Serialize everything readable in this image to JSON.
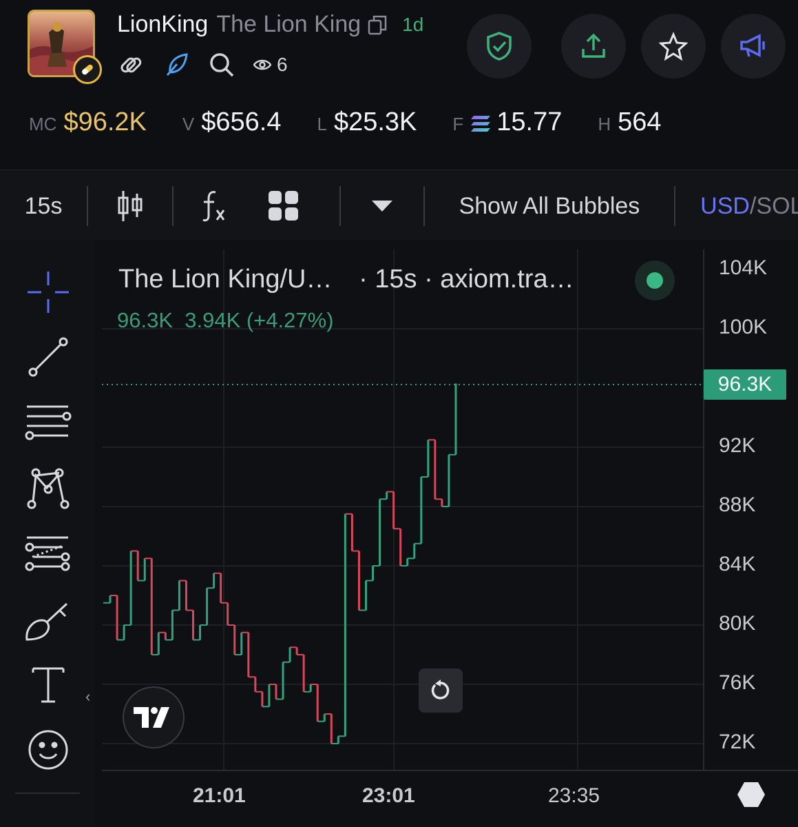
{
  "header": {
    "symbol": "LionKing",
    "name": "The Lion King",
    "age": "1d",
    "watchers": "6",
    "icons": [
      "copy-icon",
      "link-icon",
      "feather-icon",
      "search-icon",
      "eye-icon"
    ],
    "buttons": [
      "shield-check-icon",
      "share-upload-icon",
      "star-icon",
      "megaphone-icon"
    ],
    "colors": {
      "gold": "#e9c46a",
      "green": "#3db37b",
      "blue": "#5a6cf0"
    }
  },
  "stats": {
    "mc_key": "MC",
    "mc_value": "$96.2K",
    "v_key": "V",
    "v_value": "$656.4",
    "l_key": "L",
    "l_value": "$25.3K",
    "f_key": "F",
    "f_value": "15.77",
    "h_key": "H",
    "h_value": "564"
  },
  "toolbar": {
    "interval": "15s",
    "show_bubbles": "Show All Bubbles",
    "currency_active": "USD",
    "currency_sep": "/",
    "currency_other": "SOL"
  },
  "chart": {
    "legend_title": "The Lion King/U…",
    "legend_meta": "· 15s · axiom.tra…",
    "legend_values": "96.3K  3.94K (+4.27%)",
    "current_price_label": "96.3K",
    "y_ticks": [
      "104K",
      "100K",
      "92K",
      "88K",
      "84K",
      "80K",
      "76K",
      "72K"
    ],
    "x_ticks": [
      "21:01",
      "23:01",
      "23:35"
    ]
  },
  "chart_data": {
    "type": "line",
    "title": "The Lion King/U…",
    "xlabel": "",
    "ylabel": "",
    "x": [
      "21:01",
      "23:01",
      "23:35"
    ],
    "ylim": [
      72000,
      104000
    ],
    "series": [
      {
        "values": [
          81500,
          82000,
          79000,
          80000,
          85000,
          83000,
          84500,
          78000,
          79500,
          79000,
          81000,
          83000,
          81000,
          79000,
          80000,
          82500,
          83500,
          81500,
          80000,
          78000,
          79500,
          76500,
          75500,
          74500,
          76000,
          75000,
          77500,
          78500,
          78000,
          75500,
          76000,
          73500,
          74000,
          72000,
          72500,
          87500,
          85000,
          81000,
          83000,
          84000,
          88500,
          89000,
          86500,
          84000,
          84500,
          85500,
          90000,
          92500,
          88500,
          88000,
          91500,
          96300
        ]
      }
    ],
    "last_value": 96300,
    "change": "3.94K",
    "change_pct": "+4.27%",
    "grid": true
  }
}
